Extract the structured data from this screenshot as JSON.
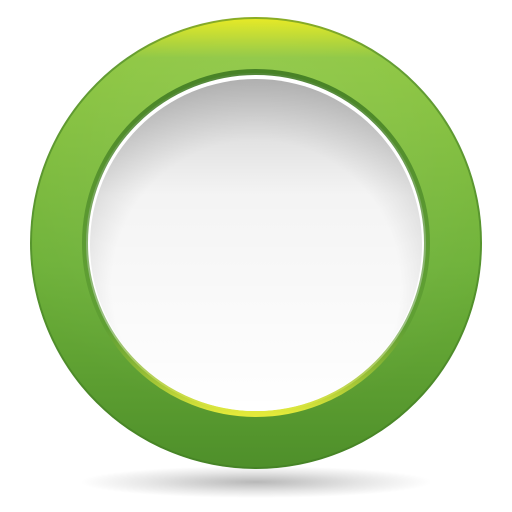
{
  "icon": {
    "name": "ring-icon",
    "colors": {
      "ring_top_highlight": "#e8ea1a",
      "ring_light": "#8cc63f",
      "ring_mid": "#6fb23a",
      "ring_dark": "#4e8f2a",
      "ring_edge": "#3f7a22",
      "inner_rim_highlight": "#e3ea3a",
      "center_fill": "#ffffff",
      "center_shadow": "#d9d9d9",
      "drop_shadow": "#9a9a9a"
    }
  }
}
